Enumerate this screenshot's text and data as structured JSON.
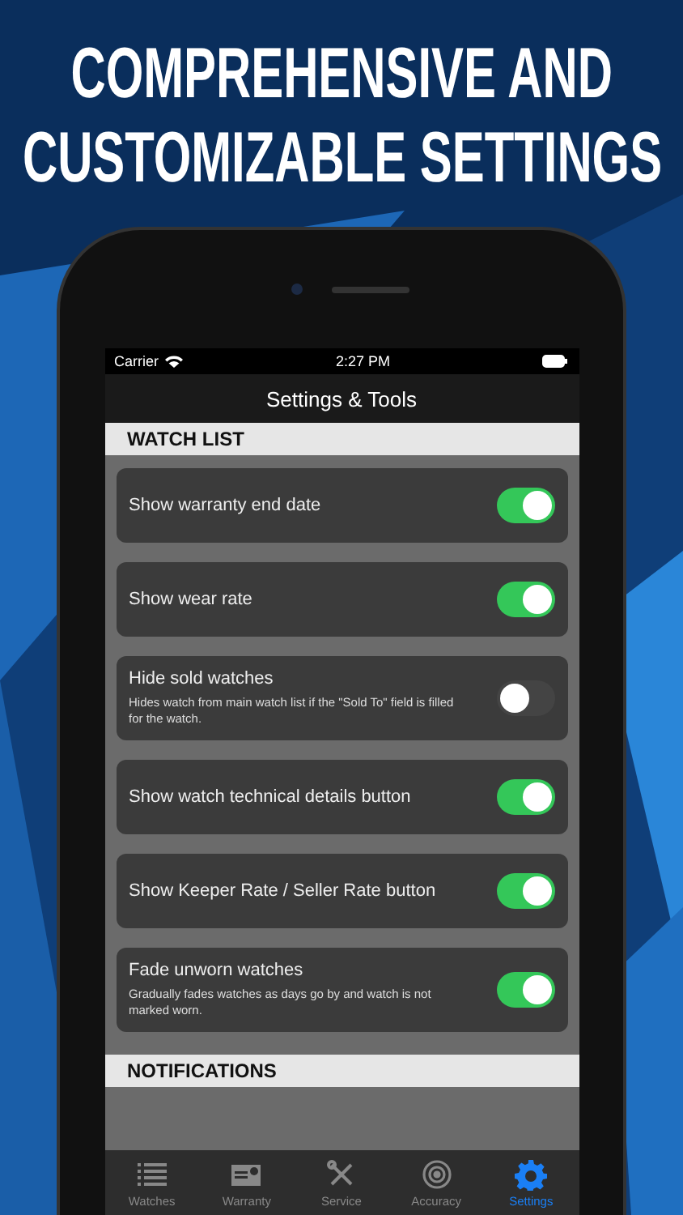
{
  "headline": [
    "COMPREHENSIVE AND",
    "CUSTOMIZABLE SETTINGS"
  ],
  "status_bar": {
    "carrier": "Carrier",
    "time": "2:27 PM"
  },
  "nav_title": "Settings & Tools",
  "sections": [
    {
      "title": "WATCH LIST",
      "rows": [
        {
          "label": "Show warranty end date",
          "on": true
        },
        {
          "label": "Show wear rate",
          "on": true
        },
        {
          "label": "Hide sold watches",
          "description": "Hides watch from main watch list if the \"Sold To\" field is filled for the watch.",
          "on": false
        },
        {
          "label": "Show watch technical details button",
          "on": true
        },
        {
          "label": "Show Keeper Rate / Seller Rate button",
          "on": true
        },
        {
          "label": "Fade unworn watches",
          "description": "Gradually fades watches as days go by and watch is not marked worn.",
          "on": true
        }
      ]
    },
    {
      "title": "NOTIFICATIONS"
    }
  ],
  "tabs": [
    {
      "label": "Watches",
      "selected": false
    },
    {
      "label": "Warranty",
      "selected": false
    },
    {
      "label": "Service",
      "selected": false
    },
    {
      "label": "Accuracy",
      "selected": false
    },
    {
      "label": "Settings",
      "selected": true
    }
  ]
}
